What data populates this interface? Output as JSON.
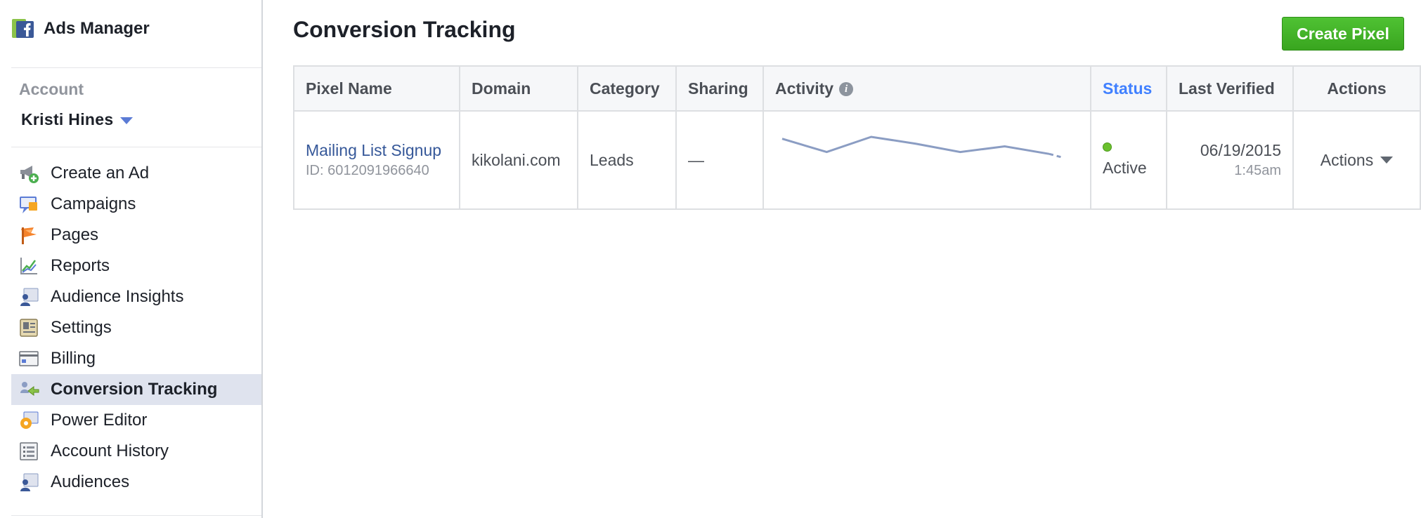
{
  "app": {
    "title": "Ads Manager"
  },
  "account": {
    "label": "Account",
    "name": "Kristi Hines"
  },
  "sidebar": {
    "items": [
      {
        "label": "Create an Ad",
        "icon": "megaphone-plus-icon"
      },
      {
        "label": "Campaigns",
        "icon": "campaigns-icon"
      },
      {
        "label": "Pages",
        "icon": "pages-flag-icon"
      },
      {
        "label": "Reports",
        "icon": "reports-chart-icon"
      },
      {
        "label": "Audience Insights",
        "icon": "audience-insights-icon"
      },
      {
        "label": "Settings",
        "icon": "settings-icon"
      },
      {
        "label": "Billing",
        "icon": "billing-icon"
      },
      {
        "label": "Conversion Tracking",
        "icon": "conversion-tracking-icon",
        "active": true
      },
      {
        "label": "Power Editor",
        "icon": "power-editor-icon"
      },
      {
        "label": "Account History",
        "icon": "account-history-icon"
      },
      {
        "label": "Audiences",
        "icon": "audiences-icon"
      }
    ]
  },
  "main": {
    "title": "Conversion Tracking",
    "create_button": "Create Pixel",
    "table": {
      "headers": {
        "pixel_name": "Pixel Name",
        "domain": "Domain",
        "category": "Category",
        "sharing": "Sharing",
        "activity": "Activity",
        "status": "Status",
        "last_verified": "Last Verified",
        "actions": "Actions"
      },
      "rows": [
        {
          "pixel_name": "Mailing List Signup",
          "pixel_id": "ID: 6012091966640",
          "domain": "kikolani.com",
          "category": "Leads",
          "sharing": "—",
          "activity": [
            0.95,
            0.6,
            1.0,
            0.82,
            0.6,
            0.75,
            0.55,
            0.45
          ],
          "status": "Active",
          "last_verified_date": "06/19/2015",
          "last_verified_time": "1:45am",
          "actions": "Actions"
        }
      ]
    }
  },
  "colors": {
    "link": "#365899",
    "status_header": "#4080ff",
    "create_button": "#42b72a",
    "active_nav_bg": "#dfe3ee",
    "sparkline": "#8b9dc3",
    "status_dot": "#6bc12e"
  }
}
